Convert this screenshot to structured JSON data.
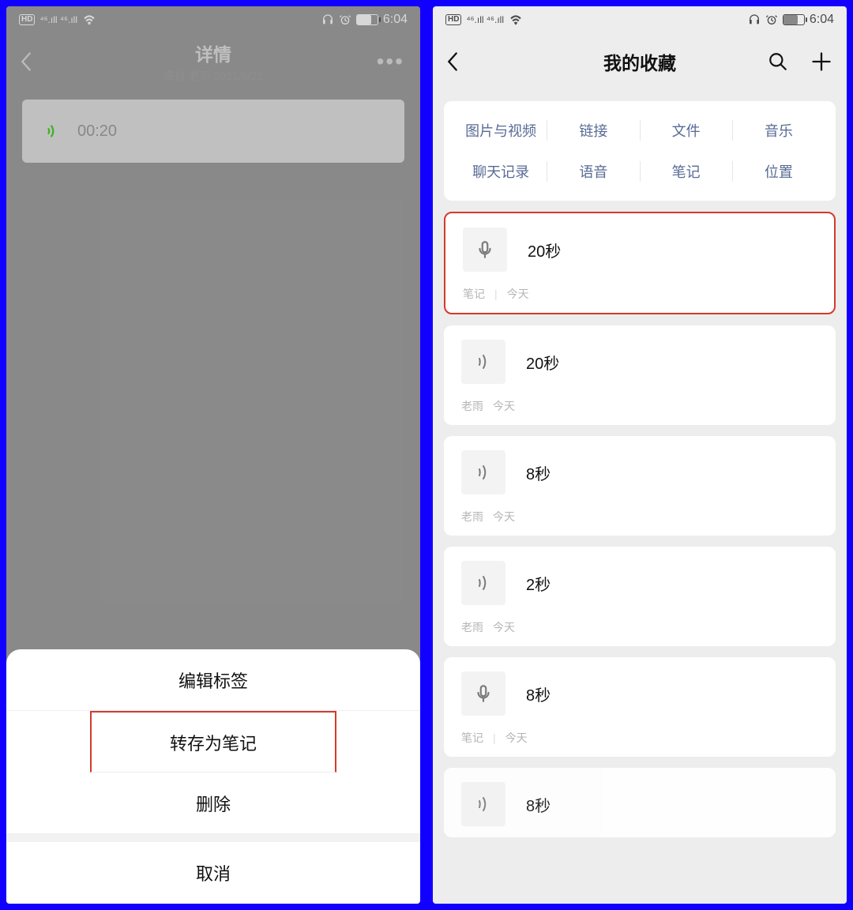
{
  "status": {
    "hd": "HD",
    "signal": "ᴳ.ıll ᴳ.ıll",
    "wifi": "wifi",
    "headset": "headset",
    "alarm": "alarm",
    "battery_pct": 70,
    "time": "6:04"
  },
  "left": {
    "title": "详情",
    "subtitle": "来自 老雨 2021/9/22",
    "voice_duration": "00:20",
    "sheet": {
      "edit_tags": "编辑标签",
      "save_as_note": "转存为笔记",
      "delete": "删除",
      "cancel": "取消"
    }
  },
  "right": {
    "title": "我的收藏",
    "categories": {
      "row1": [
        "图片与视频",
        "链接",
        "文件",
        "音乐"
      ],
      "row2": [
        "聊天记录",
        "语音",
        "笔记",
        "位置"
      ]
    },
    "items": [
      {
        "icon": "mic",
        "title": "20秒",
        "meta_left": "笔记",
        "meta_sep": "|",
        "meta_right": "今天",
        "highlight": true
      },
      {
        "icon": "sound",
        "title": "20秒",
        "meta_left": "老雨",
        "meta_sep": "",
        "meta_right": "今天",
        "highlight": false
      },
      {
        "icon": "sound",
        "title": "8秒",
        "meta_left": "老雨",
        "meta_sep": "",
        "meta_right": "今天",
        "highlight": false
      },
      {
        "icon": "sound",
        "title": "2秒",
        "meta_left": "老雨",
        "meta_sep": "",
        "meta_right": "今天",
        "highlight": false
      },
      {
        "icon": "mic",
        "title": "8秒",
        "meta_left": "笔记",
        "meta_sep": "|",
        "meta_right": "今天",
        "highlight": false
      },
      {
        "icon": "sound",
        "title": "8秒",
        "meta_left": "",
        "meta_sep": "",
        "meta_right": "",
        "highlight": false
      }
    ]
  }
}
